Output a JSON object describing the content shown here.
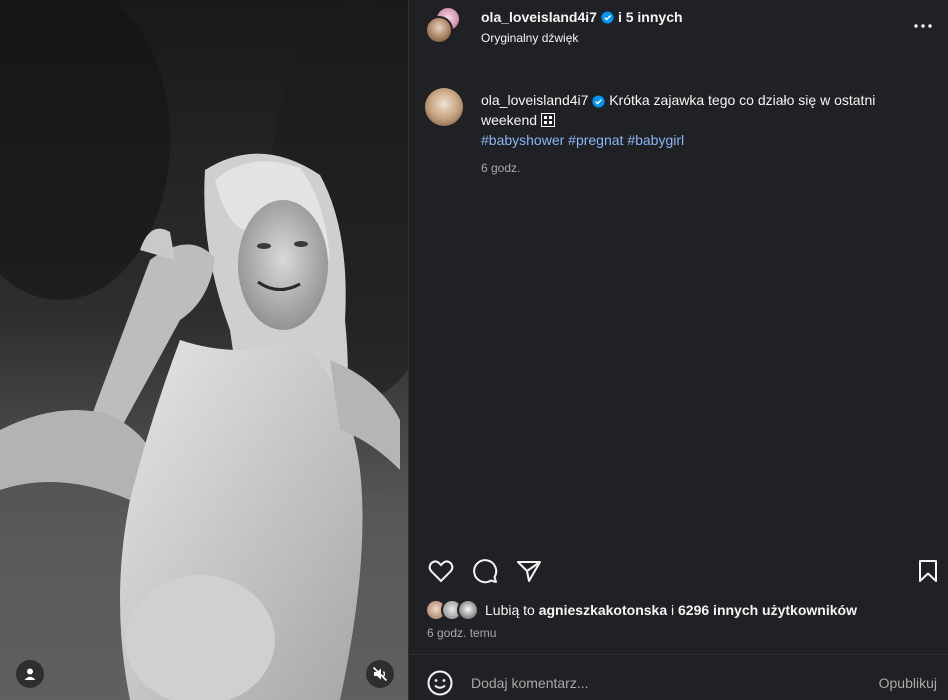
{
  "header": {
    "username": "ola_loveisland4i7",
    "others": "i 5 innych",
    "audio": "Oryginalny dźwięk"
  },
  "caption": {
    "username": "ola_loveisland4i7",
    "text": "Krótka zajawka tego co działo się w ostatni weekend",
    "hashtags": "#babyshower #pregnat #babygirl",
    "time": "6 godz."
  },
  "likes": {
    "prefix": "Lubią to",
    "user": "agnieszkakotonska",
    "connector": "i",
    "count": "6296 innych użytkowników"
  },
  "post_age": "6 godz. temu",
  "comment": {
    "placeholder": "Dodaj komentarz...",
    "publish_label": "Opublikuj"
  },
  "colors": {
    "panel_bg": "#202124",
    "verified": "#0095f6",
    "hashtag": "#8ab4f8",
    "muted_text": "#a8a8a8"
  },
  "icons": [
    "tag-user-icon",
    "mute-icon",
    "more-icon",
    "verified-icon",
    "heart-icon",
    "comment-icon",
    "share-icon",
    "bookmark-icon",
    "emoji-icon"
  ]
}
